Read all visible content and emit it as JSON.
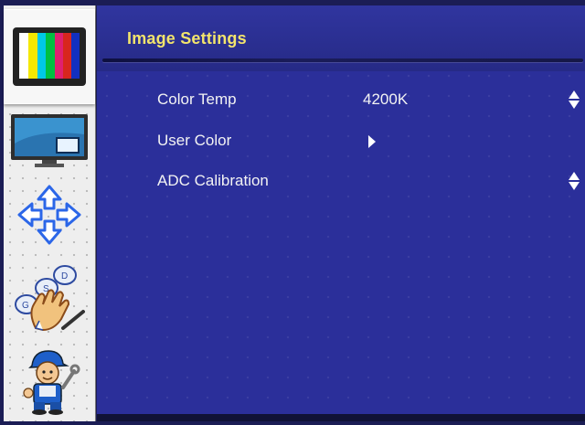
{
  "menu": {
    "title": "Image Settings",
    "items": [
      {
        "label": "Color Temp",
        "value": "4200K",
        "control": "up-down"
      },
      {
        "label": "User Color",
        "value": "",
        "control": "submenu-arrow"
      },
      {
        "label": "ADC Calibration",
        "value": "",
        "control": "up-down"
      }
    ]
  },
  "sidebar": {
    "items": [
      {
        "icon": "color-bars-icon",
        "active": true
      },
      {
        "icon": "monitor-pip-icon",
        "active": false
      },
      {
        "icon": "directional-arrows-icon",
        "active": false
      },
      {
        "icon": "hand-keypad-icon",
        "active": false
      },
      {
        "icon": "technician-icon",
        "active": false
      }
    ]
  },
  "colors": {
    "background": "#2b2f9a",
    "title_text": "#f2e46c",
    "item_text": "#f3f3f3",
    "sidebar": "#eeeeee"
  }
}
